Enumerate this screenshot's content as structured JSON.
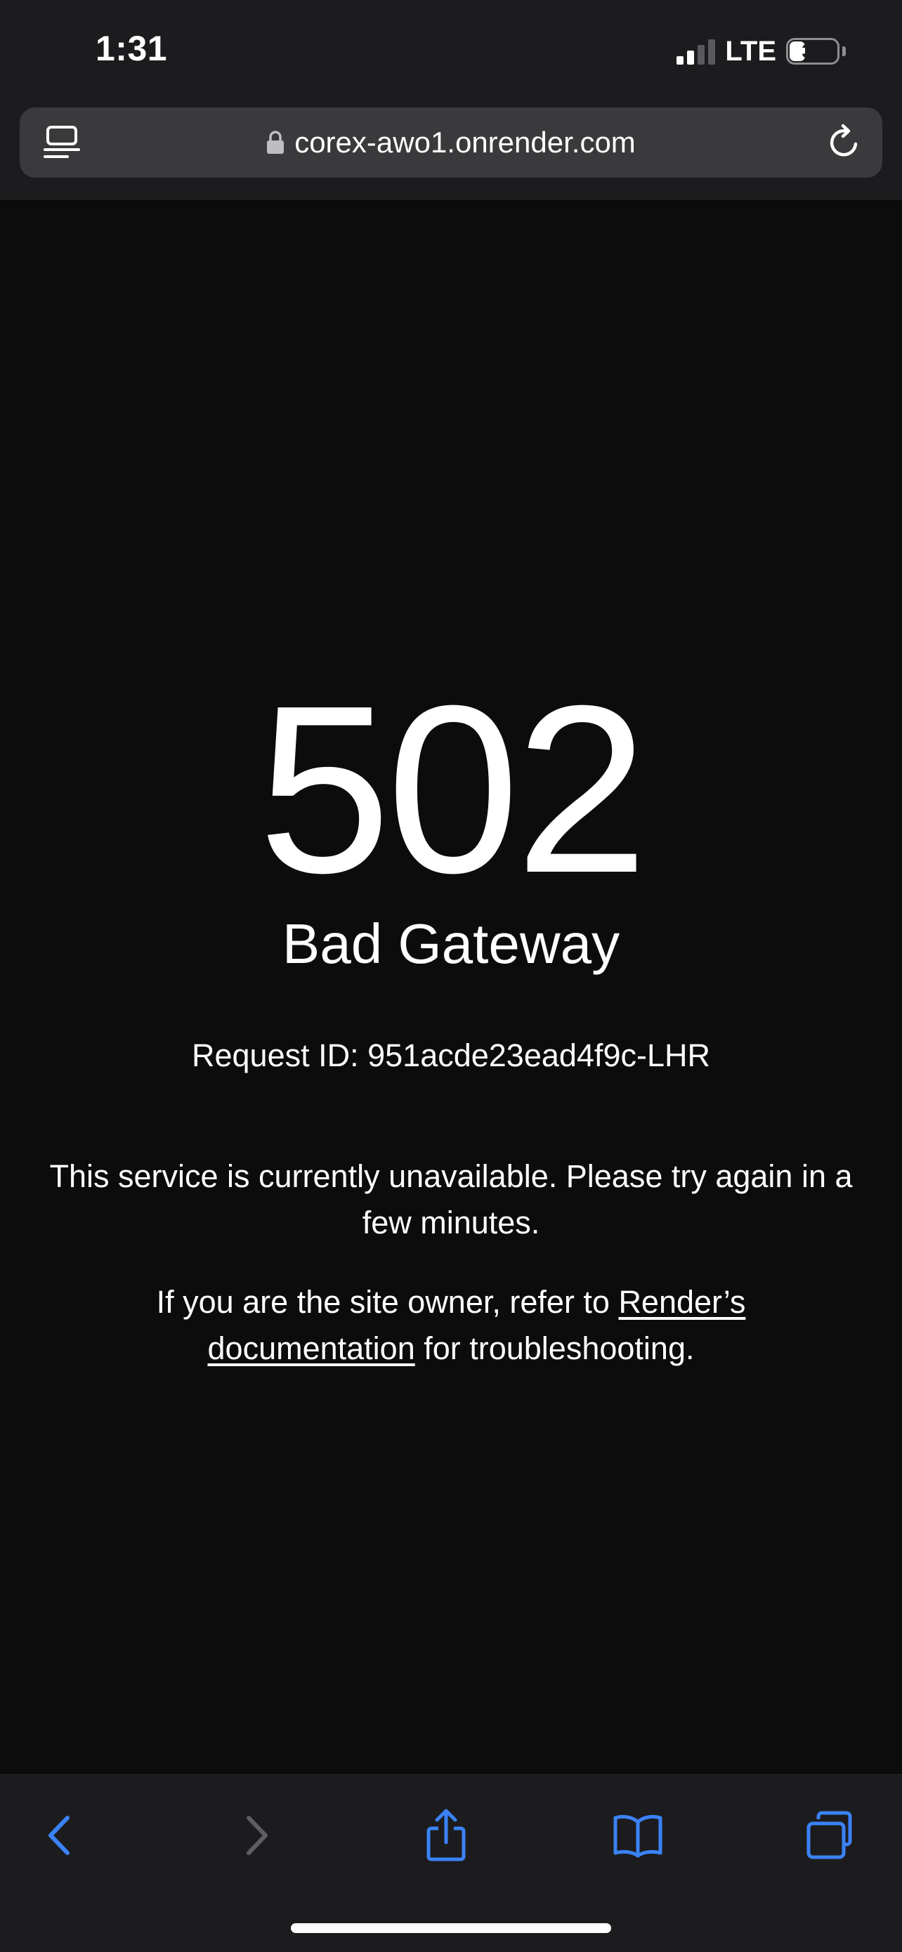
{
  "status_bar": {
    "time": "1:31",
    "network": "LTE",
    "battery_percent": "34",
    "battery_level": 0.34,
    "signal_bars_active": 2,
    "signal_bars_total": 4
  },
  "browser": {
    "url": "corex-awo1.onrender.com",
    "icons": {
      "reader": "reader-mode-icon",
      "lock": "lock-icon",
      "reload": "reload-icon"
    }
  },
  "page": {
    "code": "502",
    "title": "Bad Gateway",
    "request_id": "Request ID: 951acde23ead4f9c-LHR",
    "message": "This service is currently unavailable. Please try again in a few minutes.",
    "owner_prefix": "If you are the site owner, refer to ",
    "docs_link": "Render’s documentation",
    "owner_suffix": " for troubleshooting."
  },
  "toolbar": {
    "items": [
      "back-icon",
      "forward-icon",
      "share-icon",
      "bookmarks-icon",
      "tabs-icon"
    ],
    "accent_color": "#3b82f6",
    "disabled_color": "#5e5e62"
  }
}
